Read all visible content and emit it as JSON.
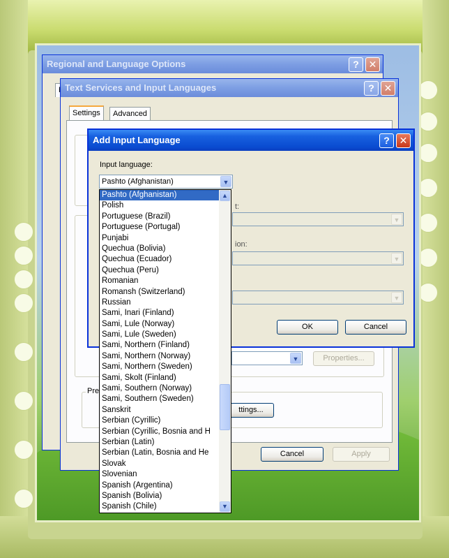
{
  "regional_window": {
    "title": "Regional and Language Options",
    "help": "?",
    "close": "✕",
    "tab_stub": "R"
  },
  "text_services_window": {
    "title": "Text Services and Input Languages",
    "help": "?",
    "close": "✕",
    "tabs": [
      "Settings",
      "Advanced"
    ],
    "properties_button": "Properties...",
    "preferences_label": "Pre",
    "key_settings_button": "ttings...",
    "cancel_button": "Cancel",
    "apply_button": "Apply"
  },
  "add_language_dialog": {
    "title": "Add Input Language",
    "help": "?",
    "close": "✕",
    "input_language_label": "Input language:",
    "selected_language": "Pashto (Afghanistan)",
    "hidden_label_1": "t:",
    "hidden_label_2": "ion:",
    "ok_button": "OK",
    "cancel_button": "Cancel"
  },
  "language_list": {
    "items": [
      "Pashto (Afghanistan)",
      "Polish",
      "Portuguese (Brazil)",
      "Portuguese (Portugal)",
      "Punjabi",
      "Quechua (Bolivia)",
      "Quechua (Ecuador)",
      "Quechua (Peru)",
      "Romanian",
      "Romansh (Switzerland)",
      "Russian",
      "Sami, Inari (Finland)",
      "Sami, Lule (Norway)",
      "Sami, Lule (Sweden)",
      "Sami, Northern (Finland)",
      "Sami, Northern (Norway)",
      "Sami, Northern (Sweden)",
      "Sami, Skolt (Finland)",
      "Sami, Southern (Norway)",
      "Sami, Southern (Sweden)",
      "Sanskrit",
      "Serbian (Cyrillic)",
      "Serbian (Cyrillic, Bosnia and H",
      "Serbian (Latin)",
      "Serbian (Latin, Bosnia and He",
      "Slovak",
      "Slovenian",
      "Spanish (Argentina)",
      "Spanish (Bolivia)",
      "Spanish (Chile)"
    ],
    "selected_index": 0
  },
  "icons": {
    "dropdown": "▼",
    "scroll_up": "▲",
    "scroll_down": "▼"
  },
  "colors": {
    "xp_title_blue": "#0a4cd1",
    "selection": "#316ac5",
    "frame_green": "#c8d48f"
  }
}
